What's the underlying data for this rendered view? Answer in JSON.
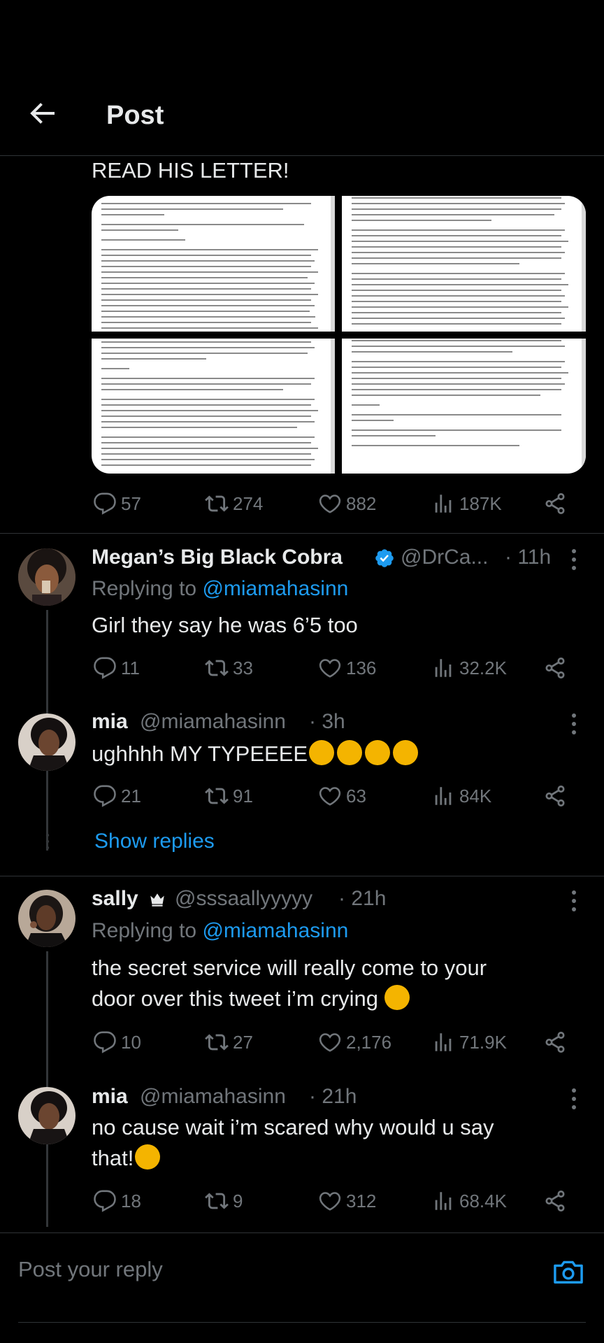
{
  "header": {
    "title": "Post"
  },
  "main_post": {
    "text": "READ HIS LETTER!",
    "stats": {
      "replies": "57",
      "reposts": "274",
      "likes": "882",
      "views": "187K"
    }
  },
  "replies": [
    {
      "name": "Megan’s Big Black Cobra",
      "handle": "@DrCa...",
      "time": "· 11h",
      "verified": true,
      "replying_label": "Replying to",
      "replying_to": "@miamahasinn",
      "text": "Girl they say he was 6’5 too",
      "stats": {
        "replies": "11",
        "reposts": "33",
        "likes": "136",
        "views": "32.2K"
      }
    },
    {
      "name": "mia",
      "handle": "@miamahasinn",
      "time": "· 3h",
      "text": "ughhhh MY TYPEEEE",
      "emojis": [
        "weary-face",
        "heart-eyes",
        "heart-eyes",
        "heart-eyes"
      ],
      "stats": {
        "replies": "21",
        "reposts": "91",
        "likes": "63",
        "views": "84K"
      }
    },
    {
      "name": "sally",
      "handle": "@sssaallyyyyy",
      "time": "· 21h",
      "name_icon": "crown-icon",
      "replying_label": "Replying to",
      "replying_to": "@miamahasinn",
      "text_line1": "the secret service will really come to your",
      "text_line2": "door over this tweet i’m crying",
      "emojis": [
        "loudly-crying-face"
      ],
      "stats": {
        "replies": "10",
        "reposts": "27",
        "likes": "2,176",
        "views": "71.9K"
      }
    },
    {
      "name": "mia",
      "handle": "@miamahasinn",
      "time": "· 21h",
      "text_line1": "no cause wait i’m scared why would u say",
      "text_line2": "that!",
      "emojis": [
        "loudly-crying-face"
      ],
      "stats": {
        "replies": "18",
        "reposts": "9",
        "likes": "312",
        "views": "68.4K"
      }
    }
  ],
  "show_replies": "Show replies",
  "reply_box": {
    "placeholder": "Post your reply"
  },
  "colors": {
    "accent": "#1d9bf0",
    "background": "#000000",
    "text": "#e7e9ea",
    "muted": "#71767b",
    "divider": "#2f3336"
  }
}
